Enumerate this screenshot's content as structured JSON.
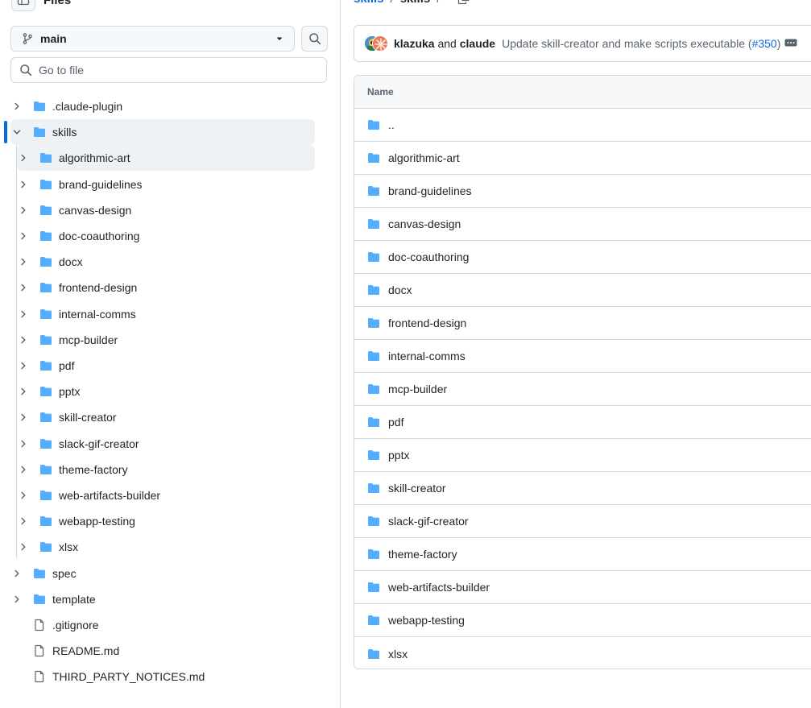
{
  "files_panel": {
    "title": "Files",
    "branch": "main",
    "goto_placeholder": "Go to file"
  },
  "tree": [
    {
      "label": ".claude-plugin",
      "type": "folder",
      "level": 0,
      "expanded": false
    },
    {
      "label": "skills",
      "type": "folder",
      "level": 0,
      "expanded": true,
      "selected": true
    },
    {
      "label": "algorithmic-art",
      "type": "folder",
      "level": 1,
      "expanded": false
    },
    {
      "label": "brand-guidelines",
      "type": "folder",
      "level": 1,
      "expanded": false
    },
    {
      "label": "canvas-design",
      "type": "folder",
      "level": 1,
      "expanded": false
    },
    {
      "label": "doc-coauthoring",
      "type": "folder",
      "level": 1,
      "expanded": false
    },
    {
      "label": "docx",
      "type": "folder",
      "level": 1,
      "expanded": false
    },
    {
      "label": "frontend-design",
      "type": "folder",
      "level": 1,
      "expanded": false
    },
    {
      "label": "internal-comms",
      "type": "folder",
      "level": 1,
      "expanded": false
    },
    {
      "label": "mcp-builder",
      "type": "folder",
      "level": 1,
      "expanded": false
    },
    {
      "label": "pdf",
      "type": "folder",
      "level": 1,
      "expanded": false
    },
    {
      "label": "pptx",
      "type": "folder",
      "level": 1,
      "expanded": false
    },
    {
      "label": "skill-creator",
      "type": "folder",
      "level": 1,
      "expanded": false
    },
    {
      "label": "slack-gif-creator",
      "type": "folder",
      "level": 1,
      "expanded": false
    },
    {
      "label": "theme-factory",
      "type": "folder",
      "level": 1,
      "expanded": false
    },
    {
      "label": "web-artifacts-builder",
      "type": "folder",
      "level": 1,
      "expanded": false
    },
    {
      "label": "webapp-testing",
      "type": "folder",
      "level": 1,
      "expanded": false
    },
    {
      "label": "xlsx",
      "type": "folder",
      "level": 1,
      "expanded": false
    },
    {
      "label": "spec",
      "type": "folder",
      "level": 0,
      "expanded": false
    },
    {
      "label": "template",
      "type": "folder",
      "level": 0,
      "expanded": false
    },
    {
      "label": ".gitignore",
      "type": "file",
      "level": 0
    },
    {
      "label": "README.md",
      "type": "file",
      "level": 0
    },
    {
      "label": "THIRD_PARTY_NOTICES.md",
      "type": "file",
      "level": 0
    }
  ],
  "breadcrumb": {
    "parent": "skills",
    "separator": "/",
    "current": "skills"
  },
  "commit": {
    "author1": "klazuka",
    "conjunction": "and",
    "author2": "claude",
    "message": "Update skill-creator and make scripts executable (",
    "pr": "#350",
    "message_end": ")"
  },
  "table": {
    "header": "Name",
    "rows": [
      "..",
      "algorithmic-art",
      "brand-guidelines",
      "canvas-design",
      "doc-coauthoring",
      "docx",
      "frontend-design",
      "internal-comms",
      "mcp-builder",
      "pdf",
      "pptx",
      "skill-creator",
      "slack-gif-creator",
      "theme-factory",
      "web-artifacts-builder",
      "webapp-testing",
      "xlsx"
    ]
  },
  "colors": {
    "folder": "#54aeff",
    "link": "#0969da",
    "active_bar": "#0969da"
  }
}
